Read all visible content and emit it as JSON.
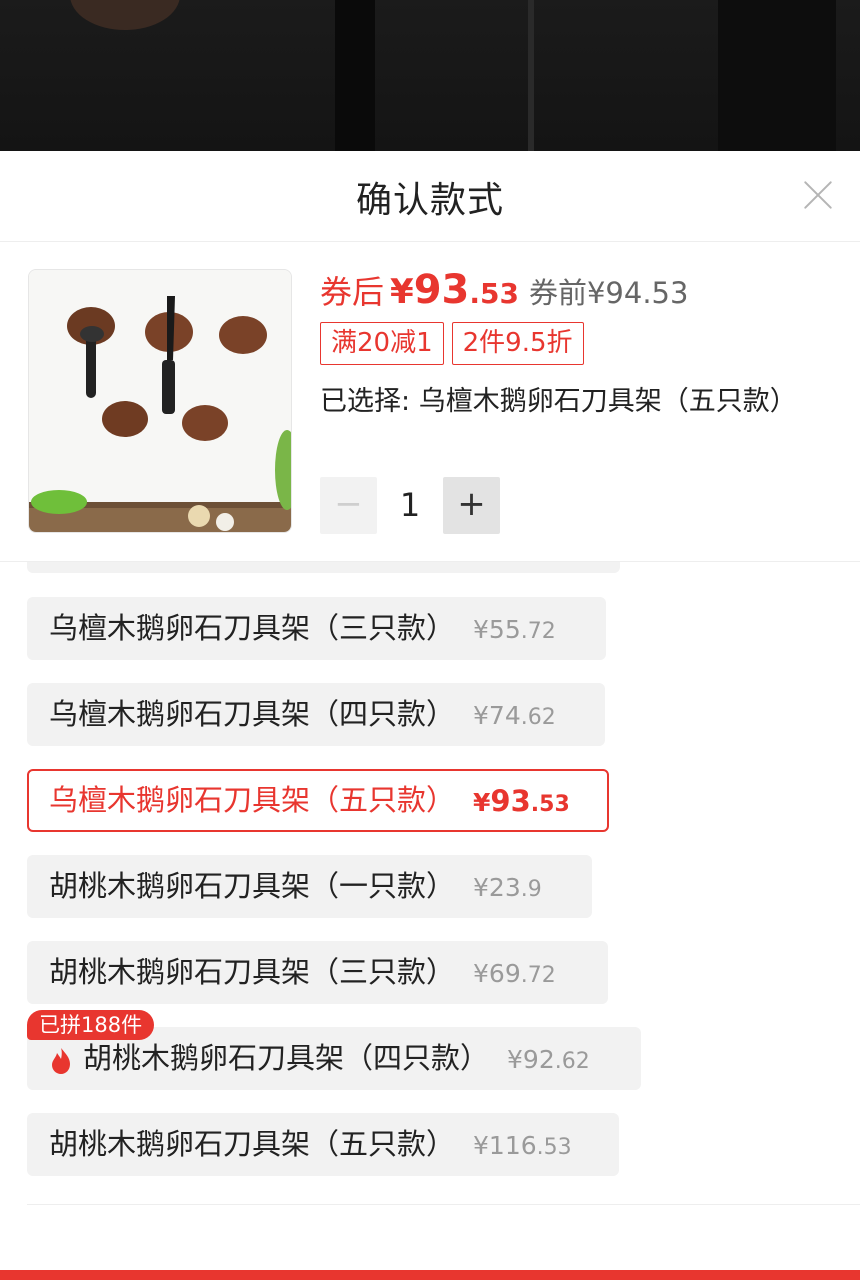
{
  "sheet": {
    "title": "确认款式"
  },
  "product": {
    "price_label": "券后",
    "price_yen": "¥",
    "price_int": "93",
    "price_dec": ".53",
    "original_price": "券前¥94.53",
    "tags": [
      "满20减1",
      "2件9.5折"
    ],
    "selected_prefix": "已选择:",
    "selected_value": "乌檀木鹅卵石刀具架（五只款）",
    "quantity": "1"
  },
  "options": [
    {
      "name": "乌檀木鹅卵石刀具架（三只款）",
      "yen": "¥",
      "int": "55",
      "dec": ".72",
      "selected": false
    },
    {
      "name": "乌檀木鹅卵石刀具架（四只款）",
      "yen": "¥",
      "int": "74",
      "dec": ".62",
      "selected": false
    },
    {
      "name": "乌檀木鹅卵石刀具架（五只款）",
      "yen": "¥",
      "int": "93",
      "dec": ".53",
      "selected": true
    },
    {
      "name": "胡桃木鹅卵石刀具架（一只款）",
      "yen": "¥",
      "int": "23",
      "dec": ".9",
      "selected": false
    },
    {
      "name": "胡桃木鹅卵石刀具架（三只款）",
      "yen": "¥",
      "int": "69",
      "dec": ".72",
      "selected": false
    },
    {
      "name": "胡桃木鹅卵石刀具架（四只款）",
      "yen": "¥",
      "int": "92",
      "dec": ".62",
      "selected": false,
      "badge": "已拼188件",
      "icon": "fire-icon"
    },
    {
      "name": "胡桃木鹅卵石刀具架（五只款）",
      "yen": "¥",
      "int": "116",
      "dec": ".53",
      "selected": false
    }
  ],
  "colors": {
    "accent": "#e8362f",
    "option_bg": "#f2f2f2"
  }
}
